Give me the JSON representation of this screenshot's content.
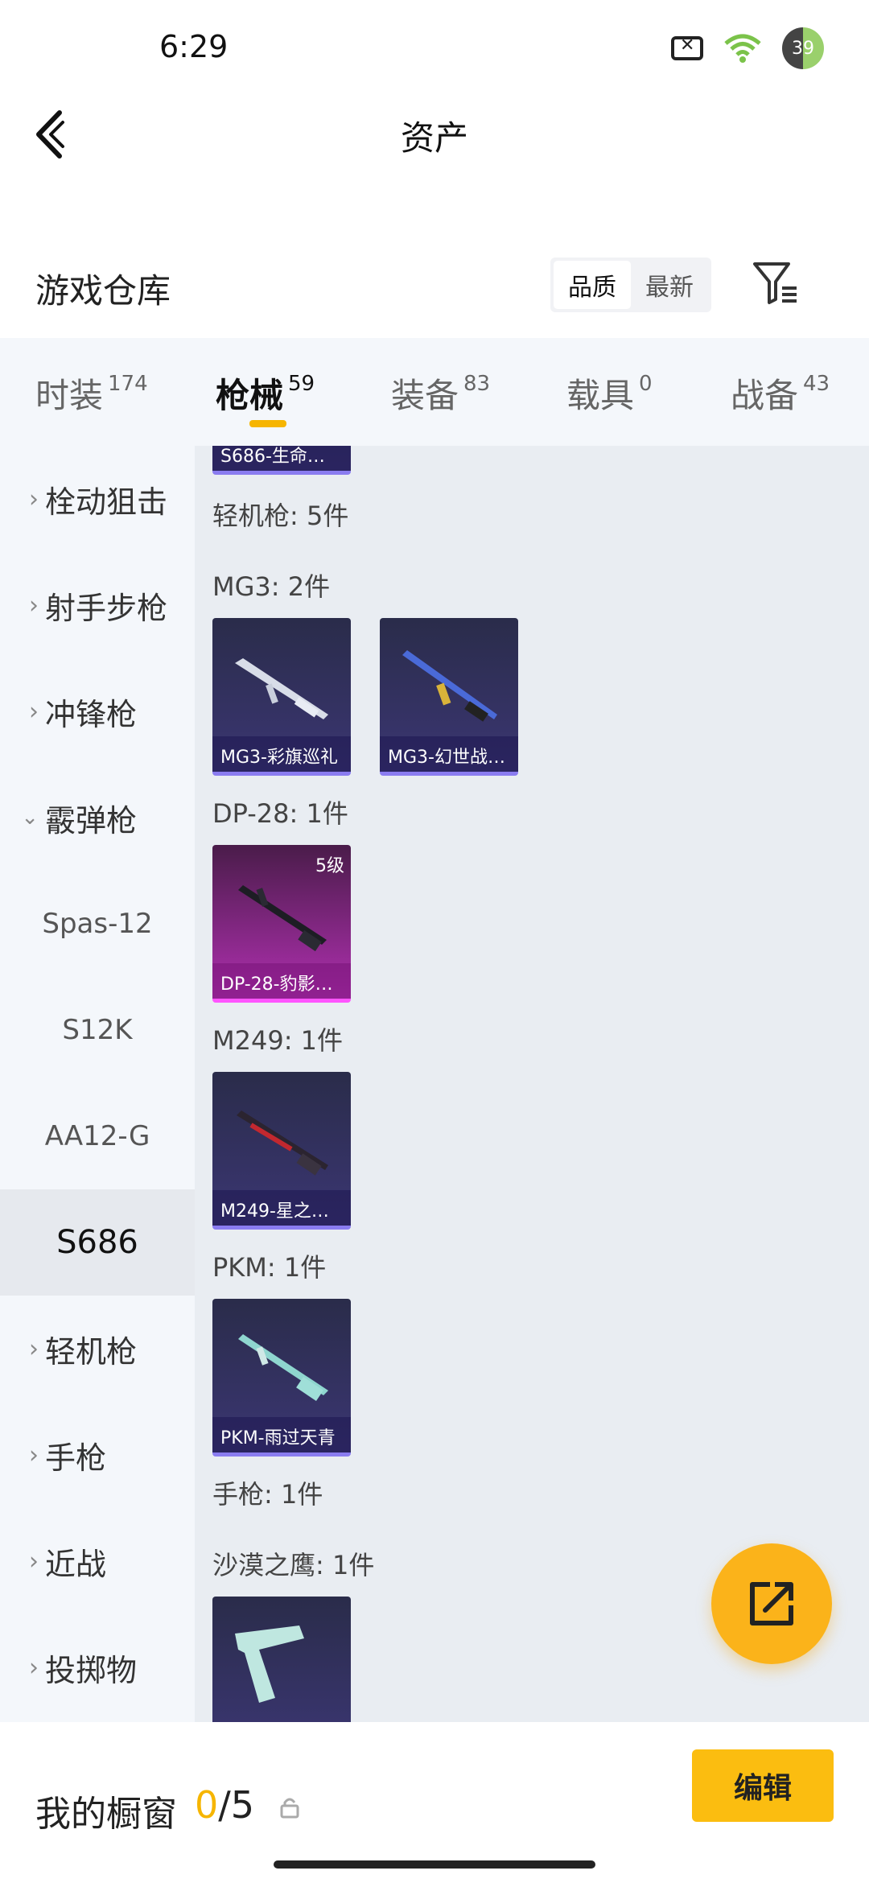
{
  "status_bar": {
    "time": "6:29",
    "battery": "39"
  },
  "header": {
    "title": "资产"
  },
  "warehouse": {
    "title": "游戏仓库",
    "sort_options": [
      "品质",
      "最新"
    ],
    "active_sort": "品质"
  },
  "tabs": [
    {
      "label": "时装",
      "count": "174"
    },
    {
      "label": "枪械",
      "count": "59",
      "active": true
    },
    {
      "label": "装备",
      "count": "83"
    },
    {
      "label": "载具",
      "count": "0"
    },
    {
      "label": "战备",
      "count": "43"
    }
  ],
  "sidebar": {
    "items": [
      {
        "label": "栓动狙击",
        "type": "collapsed"
      },
      {
        "label": "射手步枪",
        "type": "collapsed"
      },
      {
        "label": "冲锋枪",
        "type": "collapsed"
      },
      {
        "label": "霰弹枪",
        "type": "expanded"
      },
      {
        "label": "Spas-12",
        "type": "sub"
      },
      {
        "label": "S12K",
        "type": "sub"
      },
      {
        "label": "AA12-G",
        "type": "sub"
      },
      {
        "label": "S686",
        "type": "selected"
      },
      {
        "label": "轻机枪",
        "type": "collapsed"
      },
      {
        "label": "手枪",
        "type": "collapsed"
      },
      {
        "label": "近战",
        "type": "collapsed"
      },
      {
        "label": "投掷物",
        "type": "collapsed"
      }
    ]
  },
  "content": {
    "partial_card_name": "S686-生命…",
    "sections": {
      "lmg": "轻机枪: 5件",
      "mg3": "MG3: 2件",
      "dp28": "DP-28: 1件",
      "m249": "M249: 1件",
      "pkm": "PKM: 1件",
      "pistol": "手枪: 1件",
      "deagle": "沙漠之鹰: 1件"
    },
    "cards": {
      "mg3_1": "MG3-彩旗巡礼",
      "mg3_2": "MG3-幻世战…",
      "dp28_1": "DP-28-豹影…",
      "dp28_1_level": "5级",
      "m249_1": "M249-星之…",
      "pkm_1": "PKM-雨过天青"
    }
  },
  "bottom_bar": {
    "title": "我的橱窗",
    "current": "0",
    "separator": "/",
    "max": "5",
    "edit_label": "编辑"
  },
  "colors": {
    "accent": "#f6b500",
    "fab": "#fbb31a",
    "card_purple": "#3b3673",
    "card_pink": "#b030b0"
  }
}
